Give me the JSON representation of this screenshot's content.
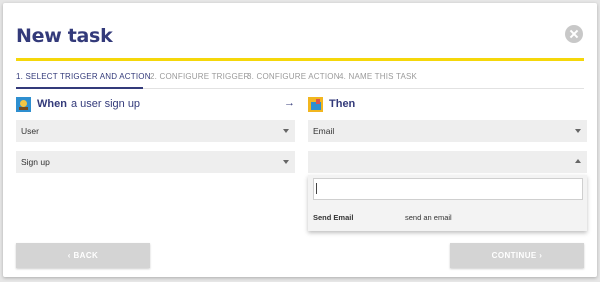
{
  "modal": {
    "title": "New task",
    "close_icon": "close-circle-icon"
  },
  "steps": [
    {
      "label": "1. SELECT TRIGGER AND ACTION",
      "active": true
    },
    {
      "label": "2. CONFIGURE TRIGGER",
      "active": false
    },
    {
      "label": "3. CONFIGURE ACTION",
      "active": false
    },
    {
      "label": "4. NAME THIS TASK",
      "active": false
    }
  ],
  "when_panel": {
    "icon": "user-avatar-icon",
    "strong": "When",
    "light": "a user sign up",
    "selects": [
      {
        "value": "User"
      },
      {
        "value": "Sign up"
      }
    ]
  },
  "arrow_icon": "arrow-right-icon",
  "then_panel": {
    "icon": "email-action-icon",
    "strong": "Then",
    "selects": [
      {
        "value": "Email"
      },
      {
        "value": ""
      }
    ],
    "dropdown": {
      "search_value": "",
      "options": [
        {
          "name": "Send Email",
          "description": "send an email"
        }
      ]
    }
  },
  "footer": {
    "back_label": "‹ BACK",
    "continue_label": "CONTINUE ›"
  },
  "colors": {
    "accent": "#333a7a",
    "highlight": "#f5d70a",
    "button_disabled": "#d4d4d4"
  }
}
